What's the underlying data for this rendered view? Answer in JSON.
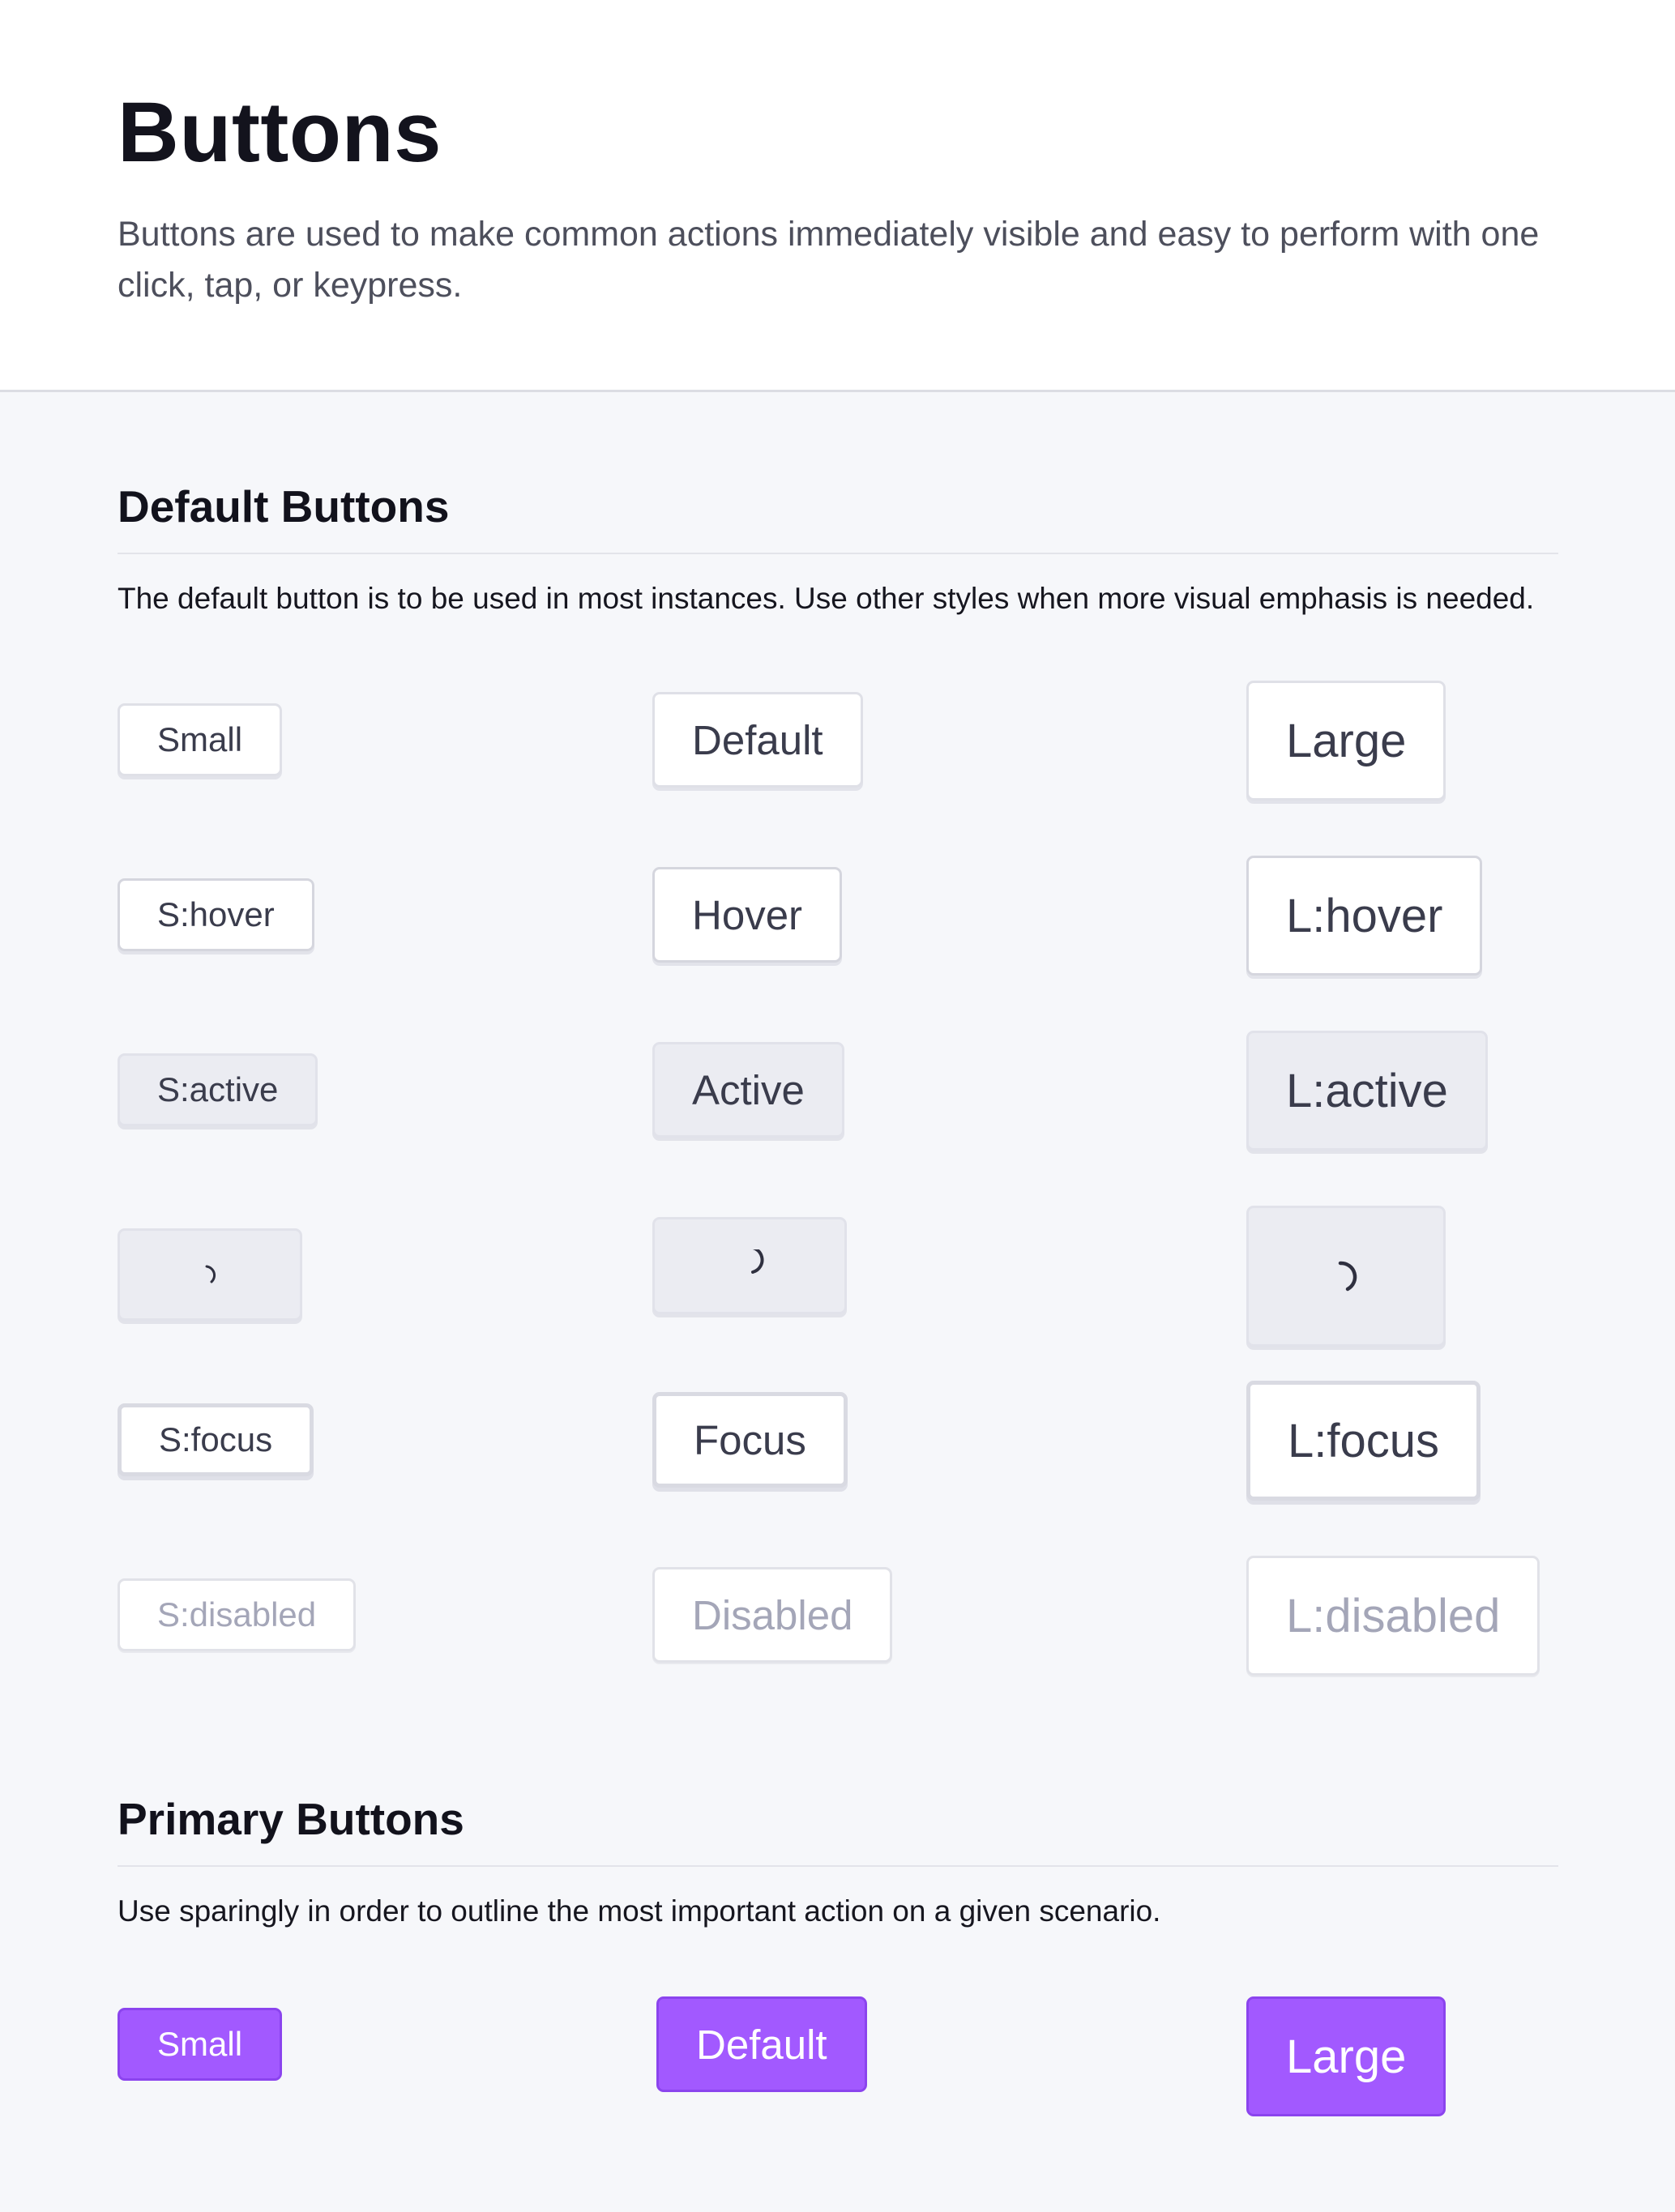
{
  "header": {
    "title": "Buttons",
    "subtitle": "Buttons are used to make common actions immediately visible and easy to perform with one click, tap, or keypress."
  },
  "default_section": {
    "title": "Default Buttons",
    "description": "The default button is to be used in most instances. Use other styles when more visual emphasis is needed.",
    "rows": {
      "default": {
        "small": "Small",
        "medium": "Default",
        "large": "Large"
      },
      "hover": {
        "small": "S:hover",
        "medium": "Hover",
        "large": "L:hover"
      },
      "active": {
        "small": "S:active",
        "medium": "Active",
        "large": "L:active"
      },
      "loading": {
        "icon": "spinner-icon"
      },
      "focus": {
        "small": "S:focus",
        "medium": "Focus",
        "large": "L:focus"
      },
      "disabled": {
        "small": "S:disabled",
        "medium": "Disabled",
        "large": "L:disabled"
      }
    }
  },
  "primary_section": {
    "title": "Primary Buttons",
    "description": "Use sparingly in order to outline the most important action on a given scenario.",
    "rows": {
      "default": {
        "small": "Small",
        "medium": "Default",
        "large": "Large"
      }
    }
  },
  "colors": {
    "primary": "#a259ff",
    "primary_border": "#8b44ee",
    "text_dark": "#12121c",
    "button_text": "#3a3c4c",
    "disabled_text": "#a4a6b8",
    "page_bg": "#f6f7fa"
  }
}
